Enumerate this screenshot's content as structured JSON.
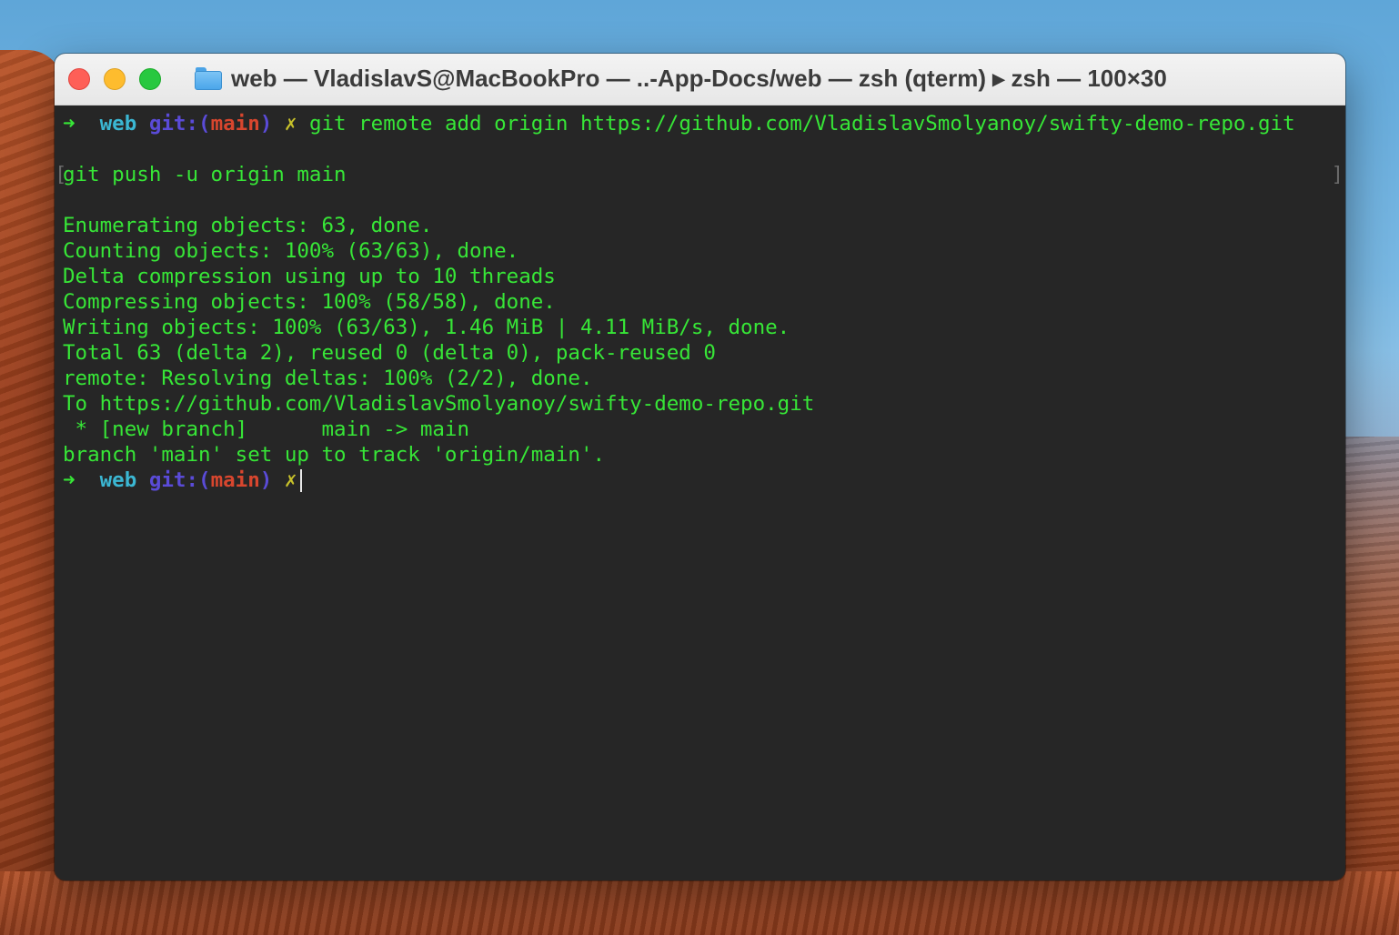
{
  "window": {
    "title": "web — VladislavS@MacBookPro — ..-App-Docs/web — zsh (qterm) ▸ zsh — 100×30",
    "folder_icon": "folder-icon"
  },
  "prompt": {
    "arrow": "➜",
    "dir": "web",
    "git_label": "git:",
    "branch_open": "(",
    "branch_name": "main",
    "branch_close": ")",
    "dirty_mark": "✗"
  },
  "terminal": {
    "command_1": "git remote add origin https://github.com/VladislavSmolyanoy/swifty-demo-repo.git",
    "command_2_open": "[",
    "command_2": "git push -u origin main",
    "command_2_close": "]",
    "output": [
      "Enumerating objects: 63, done.",
      "Counting objects: 100% (63/63), done.",
      "Delta compression using up to 10 threads",
      "Compressing objects: 100% (58/58), done.",
      "Writing objects: 100% (63/63), 1.46 MiB | 4.11 MiB/s, done.",
      "Total 63 (delta 2), reused 0 (delta 0), pack-reused 0",
      "remote: Resolving deltas: 100% (2/2), done.",
      "To https://github.com/VladislavSmolyanoy/swifty-demo-repo.git",
      " * [new branch]      main -> main",
      "branch 'main' set up to track 'origin/main'."
    ]
  },
  "colors": {
    "output_green": "#37e637",
    "dir_cyan": "#3bb7d3",
    "git_purple": "#5a4bd8",
    "branch_red": "#d8462e",
    "dirty_yellow": "#c7c12a",
    "terminal_bg": "#262626"
  }
}
